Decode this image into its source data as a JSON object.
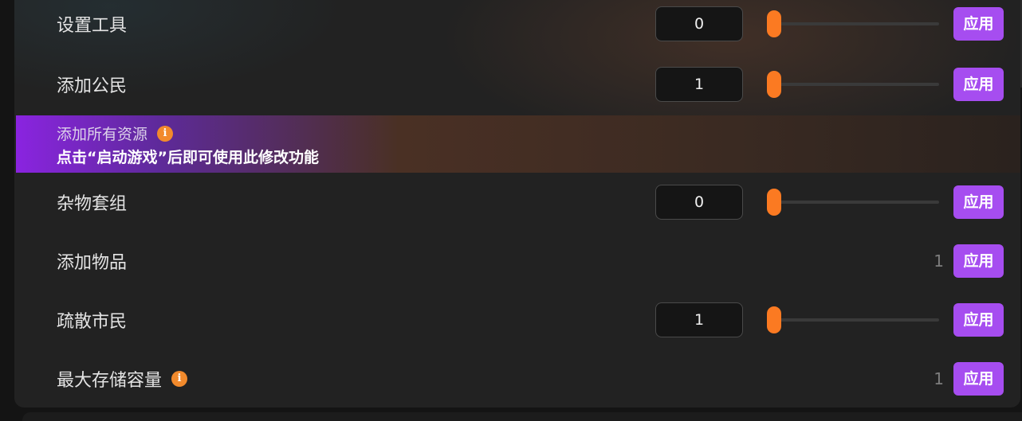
{
  "rows": [
    {
      "label": "设置工具",
      "value": "0",
      "control": "slider",
      "button": "应用"
    },
    {
      "label": "添加公民",
      "value": "1",
      "control": "slider",
      "button": "应用"
    },
    {
      "label": "杂物套组",
      "value": "0",
      "control": "slider",
      "button": "应用"
    },
    {
      "label": "添加物品",
      "value": "1",
      "control": "plain",
      "button": "应用"
    },
    {
      "label": "疏散市民",
      "value": "1",
      "control": "slider",
      "button": "应用"
    },
    {
      "label": "最大存储容量",
      "value": "1",
      "control": "plain",
      "button": "应用"
    }
  ],
  "notice": {
    "title": "添加所有资源",
    "message": "点击“启动游戏”后即可使用此修改功能"
  },
  "icons": {
    "info": "i"
  },
  "colors": {
    "accent_purple": "#a64df0",
    "slider_orange": "#fb7a22",
    "info_orange": "#f28a2c",
    "notice_purple": "#8a24e0"
  }
}
